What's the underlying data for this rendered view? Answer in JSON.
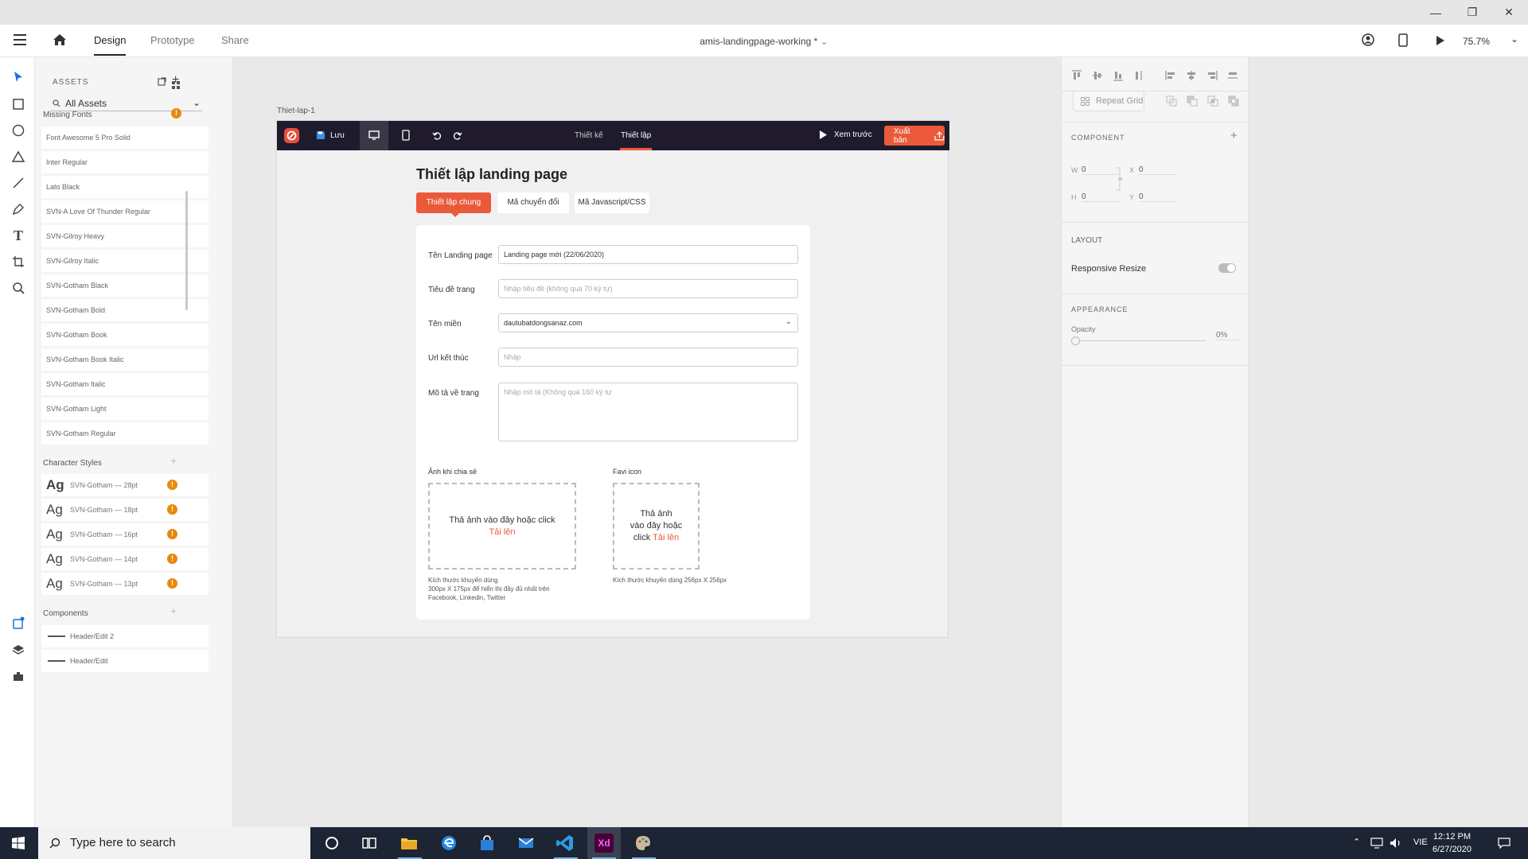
{
  "app": {
    "tabs": [
      "Design",
      "Prototype",
      "Share"
    ],
    "doc_title": "amis-landingpage-working *",
    "zoom": "75.7%"
  },
  "assets": {
    "title": "ASSETS",
    "filter": "All Assets",
    "missing_fonts_head": "Missing Fonts",
    "fonts": [
      "Font Awesome 5 Pro Solid",
      "Inter Regular",
      "Lato Black",
      "SVN-A Love Of Thunder Regular",
      "SVN-Gilroy Heavy",
      "SVN-Gilroy Italic",
      "SVN-Gotham Black",
      "SVN-Gotham Bold",
      "SVN-Gotham Book",
      "SVN-Gotham Book Italic",
      "SVN-Gotham Italic",
      "SVN-Gotham Light",
      "SVN-Gotham Regular"
    ],
    "char_styles_head": "Character Styles",
    "char_styles": [
      {
        "ag": "Ag",
        "label": "SVN-Gotham — 28pt"
      },
      {
        "ag": "Ag",
        "label": "SVN-Gotham — 18pt"
      },
      {
        "ag": "Ag",
        "label": "SVN-Gotham — 16pt"
      },
      {
        "ag": "Ag",
        "label": "SVN-Gotham — 14pt"
      },
      {
        "ag": "Ag",
        "label": "SVN-Gotham — 13pt"
      }
    ],
    "components_head": "Components",
    "components": [
      "Header/Edit 2",
      "Header/Edit"
    ]
  },
  "artboard": {
    "label": "Thiet-lap-1",
    "header": {
      "save": "Lưu",
      "tab_design": "Thiết kế",
      "tab_setup": "Thiết lập",
      "preview": "Xem trước",
      "publish": "Xuất bản"
    },
    "title": "Thiết lập landing page",
    "tabs": [
      "Thiết lập chung",
      "Mã chuyển đổi",
      "Mã Javascript/CSS"
    ],
    "form": {
      "name_label": "Tên Landing page",
      "name_value": "Landing page mới (22/06/2020)",
      "title_label": "Tiêu đề trang",
      "title_placeholder": "Nhập tiêu đề (không quá 70 ký tự)",
      "domain_label": "Tên miền",
      "domain_value": "dautubatdongsanaz.com",
      "url_label": "Url kết thúc",
      "url_placeholder": "Nhập",
      "desc_label": "Mô tả về trang",
      "desc_placeholder": "Nhập mô tả (Không quá 160 ký tự",
      "share_label": "Ảnh khi chia sẻ",
      "share_drop": "Thả ảnh vào đây hoặc click",
      "share_upload": "Tải lên",
      "share_hint_1": "Kích thước khuyến dùng",
      "share_hint_2": "300px X 175px để hiển thị đầy đủ nhất trên",
      "share_hint_3": "Facebook, Linkedin, Twitter",
      "favi_label": "Favi icon",
      "favi_drop_1": "Thả ảnh",
      "favi_drop_2": "vào đây hoặc",
      "favi_drop_3": "click",
      "favi_upload": "Tải lên",
      "favi_hint": "Kích thước khuyến dùng 256px X 256px"
    }
  },
  "props": {
    "repeat_grid": "Repeat Grid",
    "component": "COMPONENT",
    "w_label": "W",
    "w": "0",
    "h_label": "H",
    "h": "0",
    "x_label": "X",
    "x": "0",
    "y_label": "Y",
    "y": "0",
    "layout": "LAYOUT",
    "responsive": "Responsive Resize",
    "appearance": "APPEARANCE",
    "opacity_label": "Opacity",
    "opacity_value": "0%"
  },
  "taskbar": {
    "search": "Type here to search",
    "lang": "VIE",
    "time": "12:12 PM",
    "date": "6/27/2020"
  },
  "colors": {
    "accent": "#ea5a3a",
    "artboard_header": "#1f1b2c",
    "warning": "#e8890c"
  }
}
